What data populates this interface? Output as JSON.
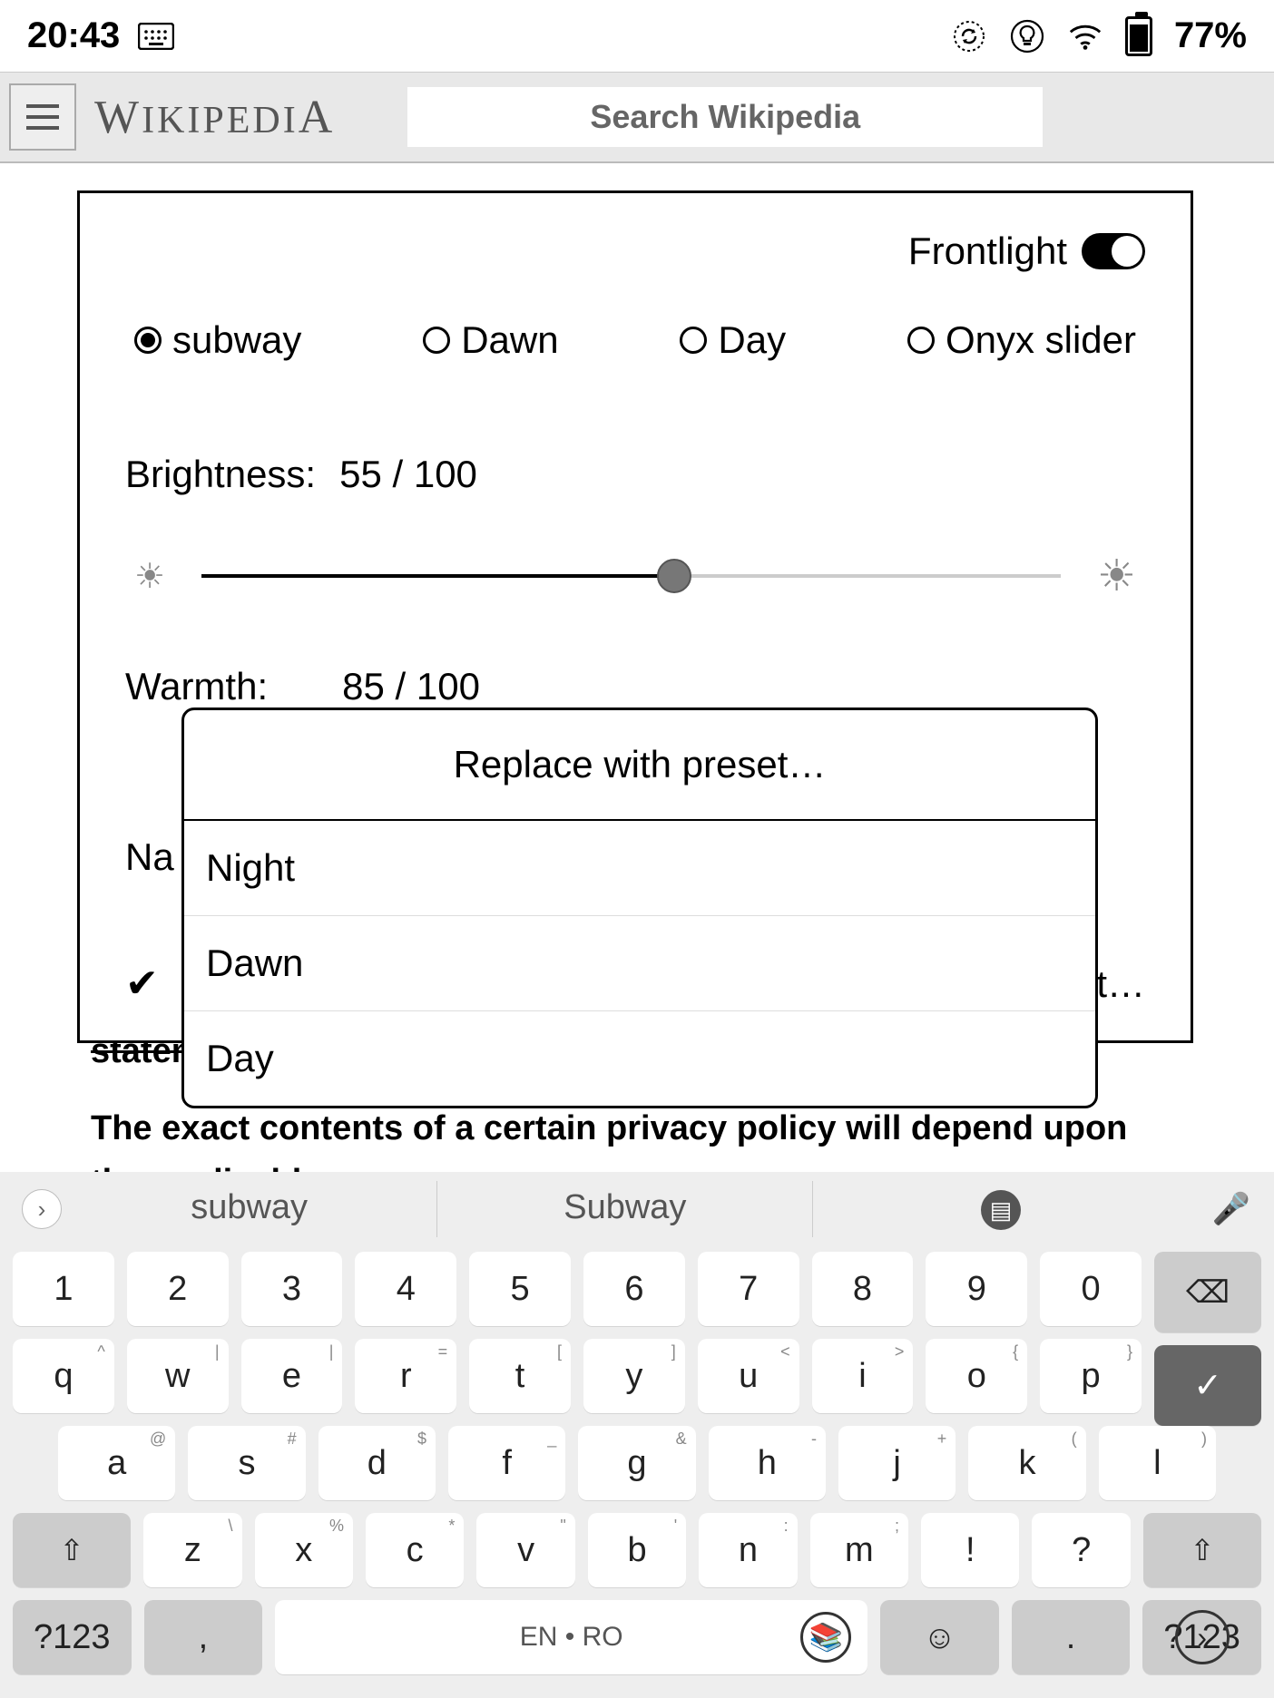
{
  "status": {
    "time": "20:43",
    "battery_pct": "77%"
  },
  "header": {
    "logo": "WIKIPEDIA",
    "search_placeholder": "Search Wikipedia"
  },
  "frontlight": {
    "title": "Frontlight",
    "enabled": true,
    "presets": [
      "subway",
      "Dawn",
      "Day",
      "Onyx slider"
    ],
    "selected_preset_index": 0,
    "brightness_label": "Brightness:",
    "brightness_value": "55 / 100",
    "brightness_pct": 55,
    "warmth_label": "Warmth:",
    "warmth_value": "85 / 100",
    "warmth_pct": 85,
    "name_label_prefix": "Na",
    "autowarmth_truncated": "t…"
  },
  "preset_menu": {
    "title": "Replace with preset…",
    "items": [
      "Night",
      "Dawn",
      "Day"
    ]
  },
  "article": {
    "line1": "statements, which tend to be more detailed and specific.",
    "line2": "The exact contents of a certain privacy policy will depend upon the applicable"
  },
  "keyboard": {
    "suggestions": [
      "subway",
      "Subway",
      ""
    ],
    "row_numbers": [
      "1",
      "2",
      "3",
      "4",
      "5",
      "6",
      "7",
      "8",
      "9",
      "0"
    ],
    "row_q": [
      {
        "k": "q",
        "s": "^"
      },
      {
        "k": "w",
        "s": "|"
      },
      {
        "k": "e",
        "s": "|"
      },
      {
        "k": "r",
        "s": "="
      },
      {
        "k": "t",
        "s": "["
      },
      {
        "k": "y",
        "s": "]"
      },
      {
        "k": "u",
        "s": "<"
      },
      {
        "k": "i",
        "s": ">"
      },
      {
        "k": "o",
        "s": "{"
      },
      {
        "k": "p",
        "s": "}"
      }
    ],
    "row_a": [
      {
        "k": "a",
        "s": "@"
      },
      {
        "k": "s",
        "s": "#"
      },
      {
        "k": "d",
        "s": "$"
      },
      {
        "k": "f",
        "s": "_"
      },
      {
        "k": "g",
        "s": "&"
      },
      {
        "k": "h",
        "s": "-"
      },
      {
        "k": "j",
        "s": "+"
      },
      {
        "k": "k",
        "s": "("
      },
      {
        "k": "l",
        "s": ")"
      }
    ],
    "row_z": [
      {
        "k": "z",
        "s": "\\"
      },
      {
        "k": "x",
        "s": "%"
      },
      {
        "k": "c",
        "s": "*"
      },
      {
        "k": "v",
        "s": "\""
      },
      {
        "k": "b",
        "s": "'"
      },
      {
        "k": "n",
        "s": ":"
      },
      {
        "k": "m",
        "s": ";"
      },
      {
        "k": "!",
        "s": ""
      },
      {
        "k": "?",
        "s": ""
      }
    ],
    "sym": "?123",
    "comma": ",",
    "space_label": "EN • RO",
    "period": ".",
    "sym2": "?123"
  }
}
